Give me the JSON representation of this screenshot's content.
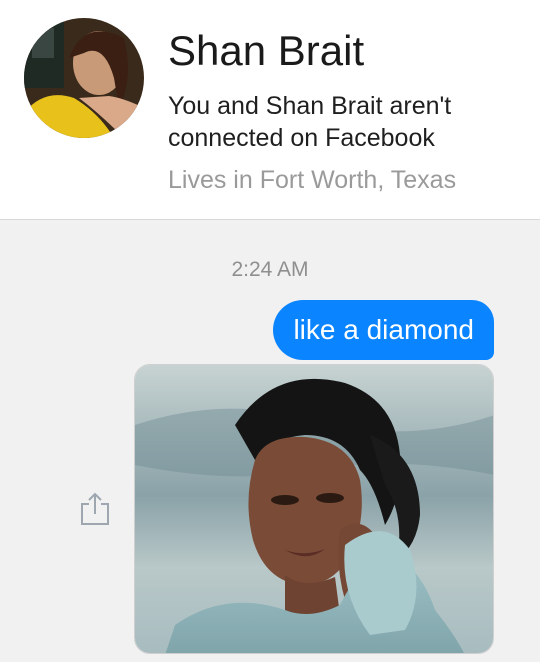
{
  "header": {
    "name": "Shan Brait",
    "connection_status": "You and Shan Brait aren't connected on Facebook",
    "location": "Lives in Fort Worth, Texas",
    "avatar_icon": "profile-photo"
  },
  "conversation": {
    "timestamp": "2:24 AM",
    "messages": [
      {
        "direction": "sent",
        "type": "text",
        "text": "like a diamond"
      },
      {
        "direction": "received",
        "type": "photo"
      }
    ],
    "share_icon": "share-upload-icon"
  },
  "colors": {
    "sent_bubble": "#0a84ff",
    "background": "#f1f1f1",
    "header_bg": "#ffffff",
    "muted_text": "#9a9a9a"
  }
}
